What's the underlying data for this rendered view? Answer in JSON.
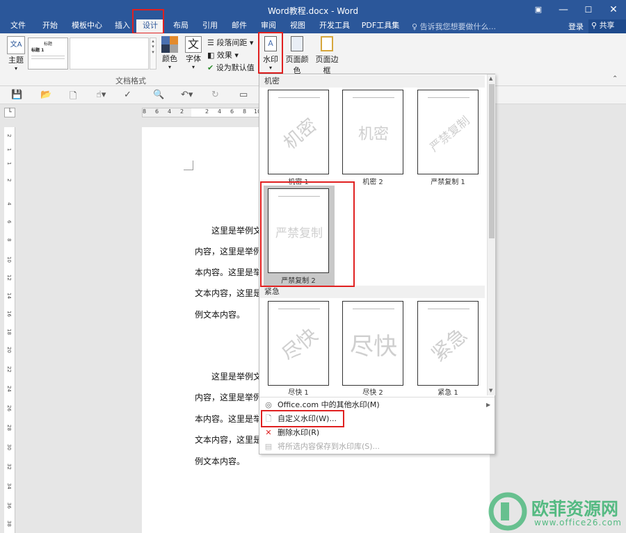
{
  "window": {
    "title": "Word教程.docx - Word"
  },
  "tabs": [
    {
      "label": "文件"
    },
    {
      "label": "开始"
    },
    {
      "label": "模板中心"
    },
    {
      "label": "插入"
    },
    {
      "label": "设计"
    },
    {
      "label": "布局"
    },
    {
      "label": "引用"
    },
    {
      "label": "邮件"
    },
    {
      "label": "审阅"
    },
    {
      "label": "视图"
    },
    {
      "label": "开发工具"
    },
    {
      "label": "PDF工具集"
    }
  ],
  "tellme": "告诉我您想要做什么...",
  "login": "登录",
  "share": "共享",
  "ribbon": {
    "theme": "主题",
    "style_title": "标题",
    "style_heading": "标题 1",
    "colors": "颜色",
    "fonts": "字体",
    "paragraph_spacing": "段落间距",
    "effects": "效果",
    "set_default": "设为默认值",
    "watermark": "水印",
    "page_color": "页面颜色",
    "page_borders": "页面边框",
    "group_doc_format": "文档格式"
  },
  "ruler": {
    "h_numbers": [
      "8",
      "6",
      "4",
      "2",
      "",
      "2",
      "4",
      "6",
      "8",
      "10"
    ],
    "v_numbers": [
      "2",
      "1",
      "1",
      "2",
      "4",
      "6",
      "8",
      "10",
      "12",
      "14",
      "16",
      "18",
      "20",
      "22",
      "24",
      "26",
      "28",
      "30",
      "32",
      "34",
      "36",
      "38"
    ]
  },
  "document": {
    "lines": [
      "这里是举例文",
      "内容，这里是举例",
      "本内容。这里是举",
      "文本内容，这里是",
      "例文本内容。",
      "这里是举例文",
      "内容，这里是举例",
      "本内容。这里是举",
      "文本内容，这里是",
      "例文本内容。"
    ]
  },
  "watermark_gallery": {
    "sections": [
      {
        "label": "机密"
      },
      {
        "label": "紧急"
      }
    ],
    "items": [
      {
        "label": "机密 1",
        "text": "机密"
      },
      {
        "label": "机密 2",
        "text": "机密"
      },
      {
        "label": "严禁复制 1",
        "text": "严禁复制"
      },
      {
        "label": "严禁复制 2",
        "text": "严禁复制"
      },
      {
        "label": "尽快 1",
        "text": "尽快"
      },
      {
        "label": "尽快 2",
        "text": "尽快"
      },
      {
        "label": "紧急 1",
        "text": "紧急"
      }
    ],
    "menu": [
      {
        "label": "Office.com 中的其他水印(M)",
        "icon": "office-icon",
        "enabled": true
      },
      {
        "label": "自定义水印(W)...",
        "icon": "document-icon",
        "enabled": true
      },
      {
        "label": "删除水印(R)",
        "icon": "delete-icon",
        "enabled": true
      },
      {
        "label": "将所选内容保存到水印库(S)...",
        "icon": "save-icon",
        "enabled": false
      }
    ]
  },
  "brand": {
    "name": "欧菲资源网",
    "url": "www.office26.com"
  },
  "colors": {
    "titlebar": "#2b579a",
    "highlight": "#e02020",
    "brand_green": "#3cb371"
  }
}
